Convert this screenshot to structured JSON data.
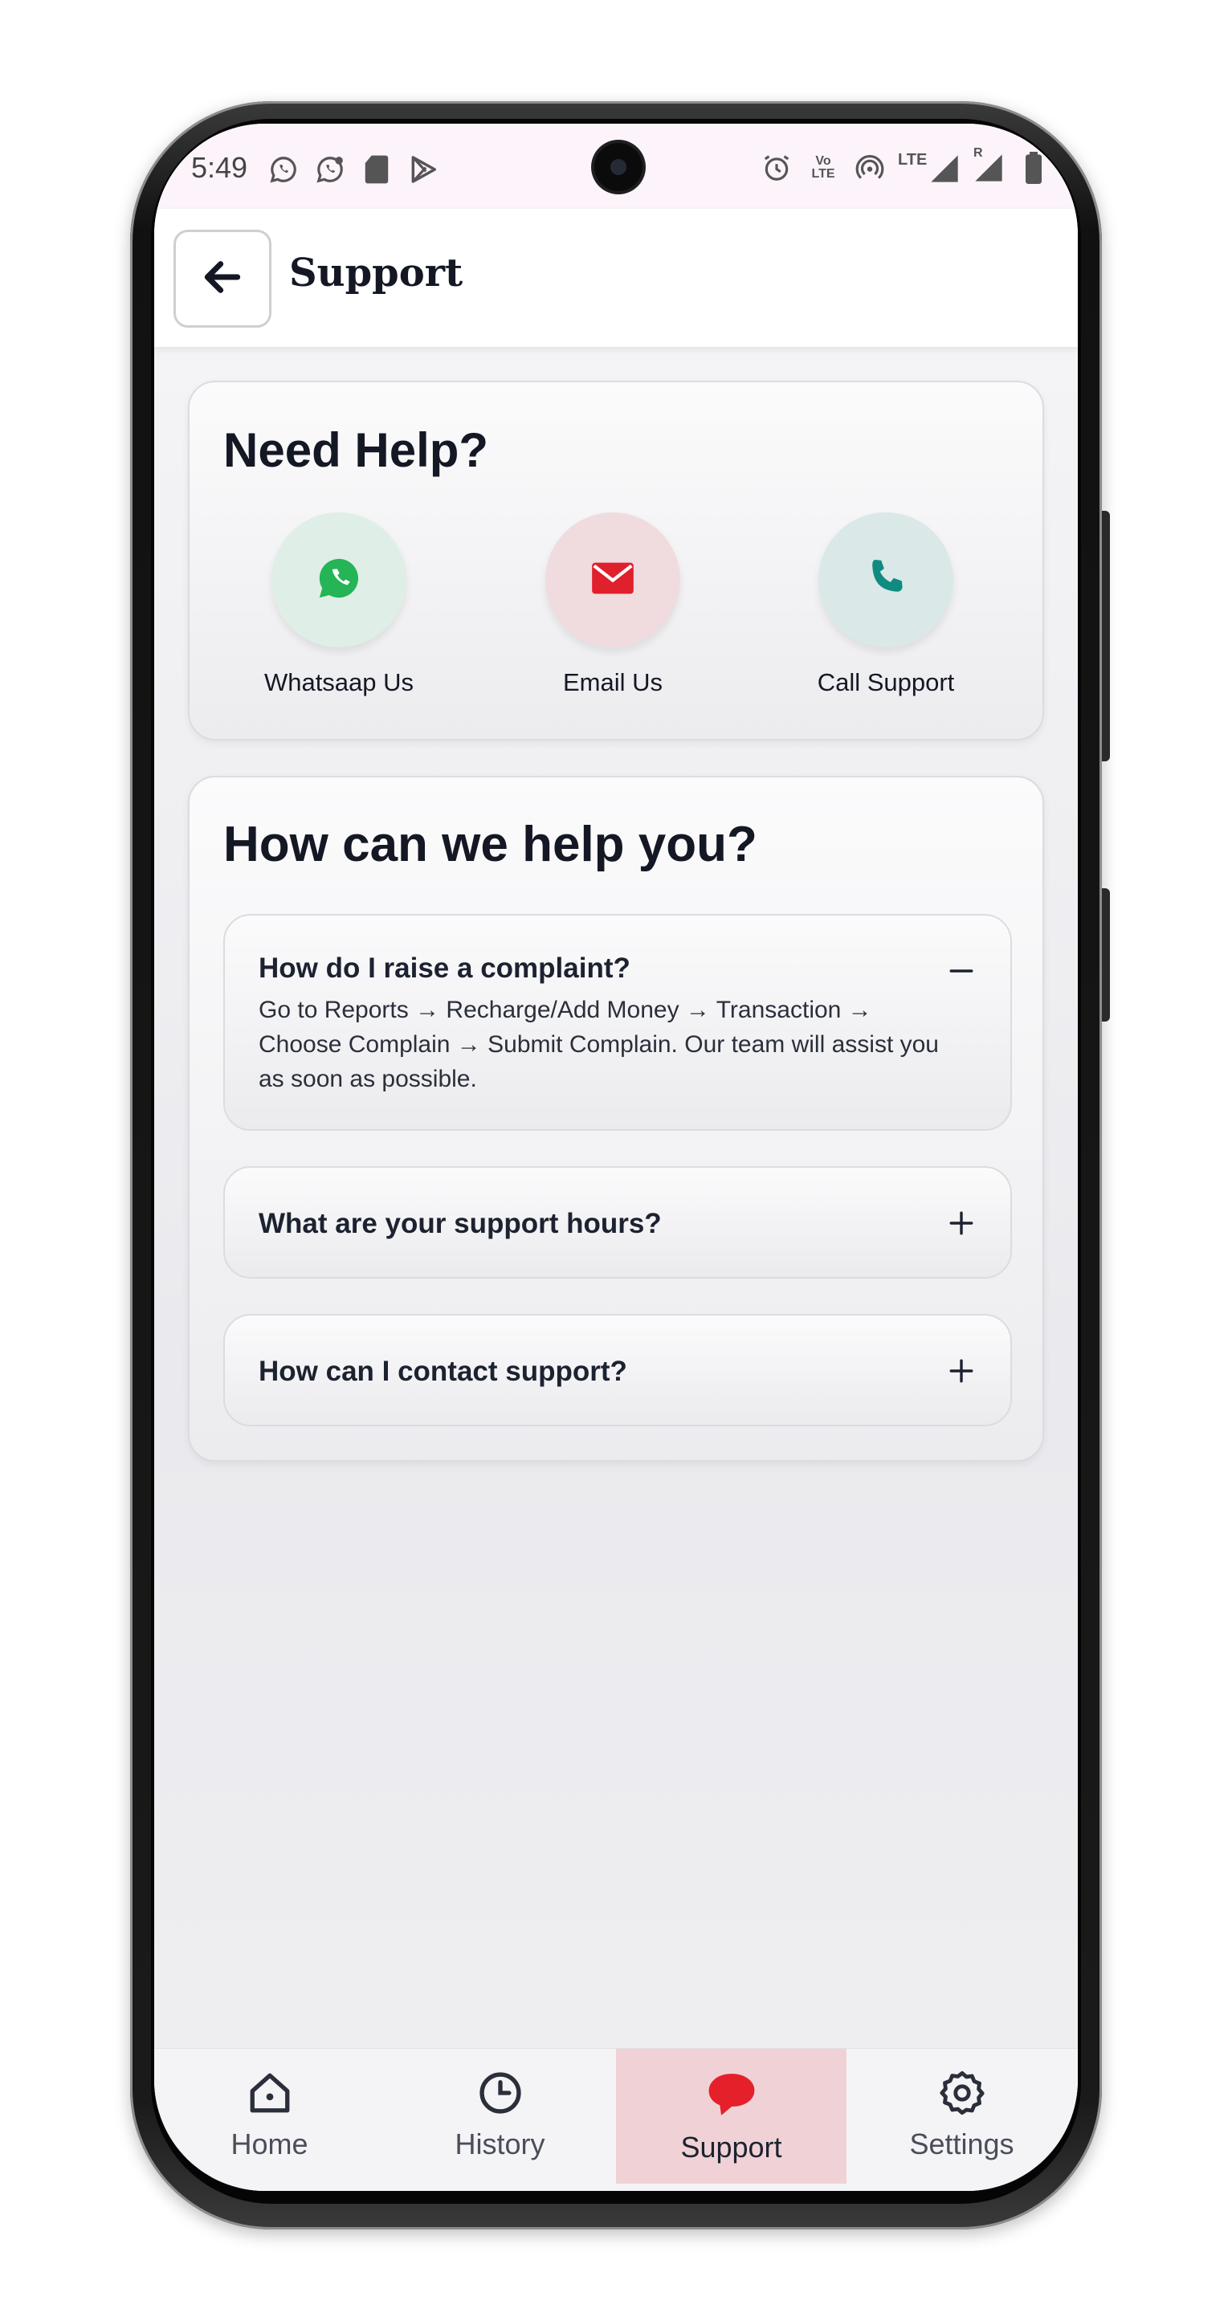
{
  "status_bar": {
    "time": "5:49",
    "left_icons": [
      "whatsapp-icon",
      "whatsapp-business-icon",
      "sd-card-icon",
      "play-store-icon"
    ],
    "right_icons": [
      "alarm-icon",
      "volte-icon",
      "hotspot-icon",
      "lte-signal-icon",
      "signal-roaming-icon",
      "battery-icon"
    ],
    "volte_text": "Vo LTE",
    "lte_text": "LTE",
    "roaming_text": "R"
  },
  "app_bar": {
    "title": "Support",
    "back_icon": "arrow-left-icon"
  },
  "need_help": {
    "title": "Need Help?",
    "contacts": [
      {
        "label": "Whatsaap Us",
        "icon": "whatsapp-icon",
        "color": "#25b456"
      },
      {
        "label": "Email Us",
        "icon": "mail-icon",
        "color": "#e0202c"
      },
      {
        "label": "Call Support",
        "icon": "phone-icon",
        "color": "#0f8b80"
      }
    ]
  },
  "faq": {
    "title": "How can we help you?",
    "items": [
      {
        "question": "How do I raise a complaint?",
        "answer": "Go to Reports → Recharge/Add Money → Transaction → Choose Complain → Submit Complain. Our team will assist you as soon as possible.",
        "expanded": true
      },
      {
        "question": "What are your support hours?",
        "expanded": false
      },
      {
        "question": "How can I contact support?",
        "expanded": false
      }
    ]
  },
  "bottom_nav": {
    "items": [
      {
        "label": "Home",
        "icon": "home-icon"
      },
      {
        "label": "History",
        "icon": "clock-icon"
      },
      {
        "label": "Support",
        "icon": "chat-bubble-icon",
        "active": true
      },
      {
        "label": "Settings",
        "icon": "gear-icon"
      }
    ],
    "active_color": "#e5202b",
    "active_bg": "#f0d2d6"
  }
}
